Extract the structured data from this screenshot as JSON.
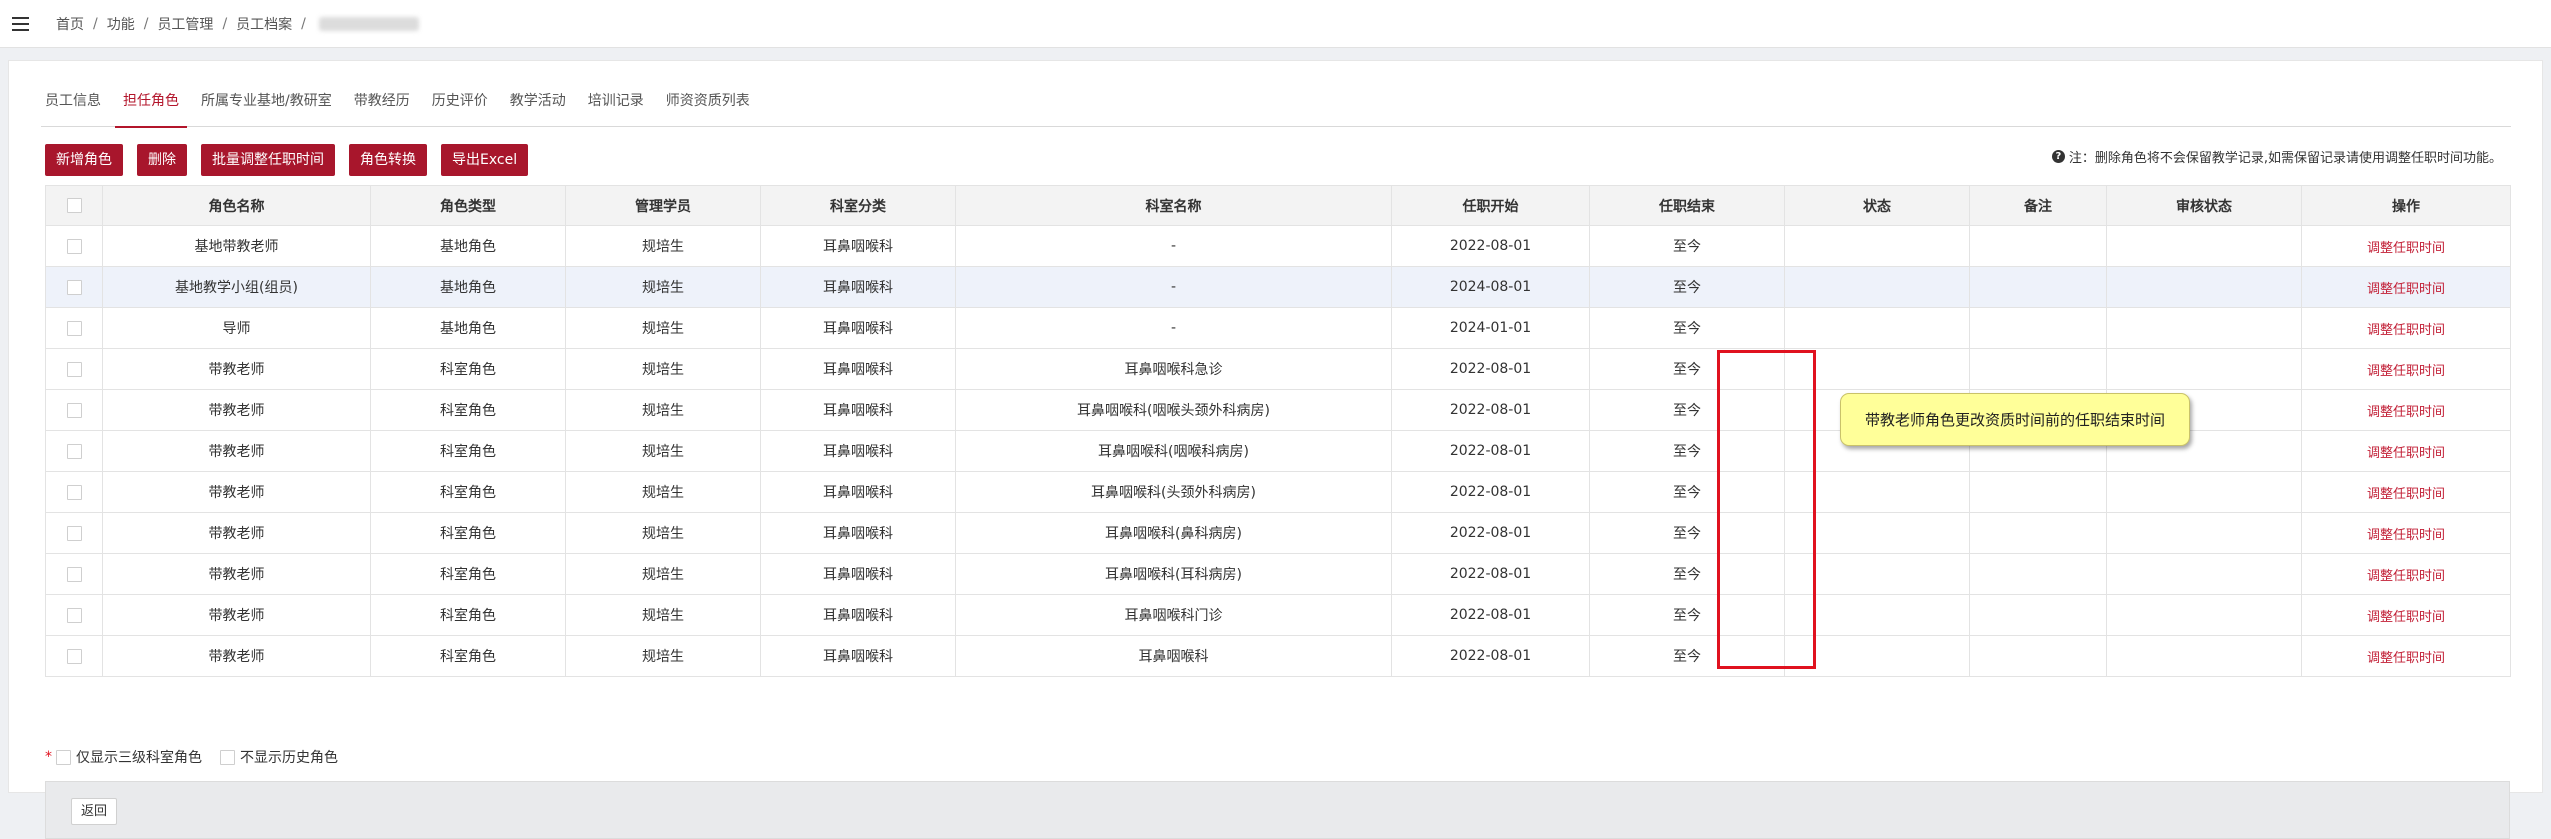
{
  "breadcrumb": [
    "首页",
    "功能",
    "员工管理",
    "员工档案"
  ],
  "tabs": [
    "员工信息",
    "担任角色",
    "所属专业基地/教研室",
    "带教经历",
    "历史评价",
    "教学活动",
    "培训记录",
    "师资资质列表"
  ],
  "toolbar": [
    "新增角色",
    "删除",
    "批量调整任职时间",
    "角色转换",
    "导出Excel"
  ],
  "note": "注：删除角色将不会保留教学记录,如需保留记录请使用调整任职时间功能。",
  "columns": [
    "角色名称",
    "角色类型",
    "管理学员",
    "科室分类",
    "科室名称",
    "任职开始",
    "任职结束",
    "状态",
    "备注",
    "审核状态",
    "操作"
  ],
  "rows": [
    [
      "基地带教老师",
      "基地角色",
      "规培生",
      "耳鼻咽喉科",
      "-",
      "2022-08-01",
      "至今",
      "",
      "",
      "",
      "调整任职时间"
    ],
    [
      "基地教学小组(组员)",
      "基地角色",
      "规培生",
      "耳鼻咽喉科",
      "-",
      "2024-08-01",
      "至今",
      "",
      "",
      "",
      "调整任职时间"
    ],
    [
      "导师",
      "基地角色",
      "规培生",
      "耳鼻咽喉科",
      "-",
      "2024-01-01",
      "至今",
      "",
      "",
      "",
      "调整任职时间"
    ],
    [
      "带教老师",
      "科室角色",
      "规培生",
      "耳鼻咽喉科",
      "耳鼻咽喉科急诊",
      "2022-08-01",
      "至今",
      "",
      "",
      "",
      "调整任职时间"
    ],
    [
      "带教老师",
      "科室角色",
      "规培生",
      "耳鼻咽喉科",
      "耳鼻咽喉科(咽喉头颈外科病房)",
      "2022-08-01",
      "至今",
      "",
      "",
      "",
      "调整任职时间"
    ],
    [
      "带教老师",
      "科室角色",
      "规培生",
      "耳鼻咽喉科",
      "耳鼻咽喉科(咽喉科病房)",
      "2022-08-01",
      "至今",
      "",
      "",
      "",
      "调整任职时间"
    ],
    [
      "带教老师",
      "科室角色",
      "规培生",
      "耳鼻咽喉科",
      "耳鼻咽喉科(头颈外科病房)",
      "2022-08-01",
      "至今",
      "",
      "",
      "",
      "调整任职时间"
    ],
    [
      "带教老师",
      "科室角色",
      "规培生",
      "耳鼻咽喉科",
      "耳鼻咽喉科(鼻科病房)",
      "2022-08-01",
      "至今",
      "",
      "",
      "",
      "调整任职时间"
    ],
    [
      "带教老师",
      "科室角色",
      "规培生",
      "耳鼻咽喉科",
      "耳鼻咽喉科(耳科病房)",
      "2022-08-01",
      "至今",
      "",
      "",
      "",
      "调整任职时间"
    ],
    [
      "带教老师",
      "科室角色",
      "规培生",
      "耳鼻咽喉科",
      "耳鼻咽喉科门诊",
      "2022-08-01",
      "至今",
      "",
      "",
      "",
      "调整任职时间"
    ],
    [
      "带教老师",
      "科室角色",
      "规培生",
      "耳鼻咽喉科",
      "耳鼻咽喉科",
      "2022-08-01",
      "至今",
      "",
      "",
      "",
      "调整任职时间"
    ]
  ],
  "tooltip": "带教老师角色更改资质时间前的任职结束时间",
  "filters": [
    "仅显示三级科室角色",
    "不显示历史角色"
  ],
  "back_label": "返回",
  "colors": {
    "accent": "#a8162c",
    "highlight": "#e0121f",
    "tooltip_bg": "#ffff99"
  }
}
